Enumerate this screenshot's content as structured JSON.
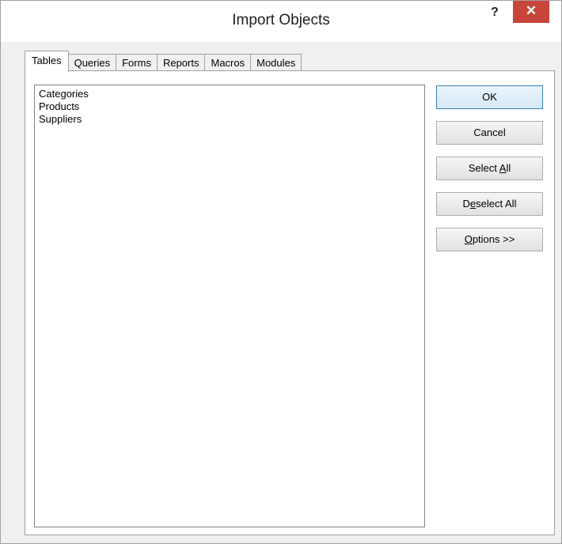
{
  "window": {
    "title": "Import Objects",
    "help_label": "?",
    "close_label": "✕"
  },
  "tabs": [
    {
      "label": "Tables",
      "active": true
    },
    {
      "label": "Queries",
      "active": false
    },
    {
      "label": "Forms",
      "active": false
    },
    {
      "label": "Reports",
      "active": false
    },
    {
      "label": "Macros",
      "active": false
    },
    {
      "label": "Modules",
      "active": false
    }
  ],
  "list": {
    "items": [
      "Categories",
      "Products",
      "Suppliers"
    ]
  },
  "buttons": {
    "ok": "OK",
    "cancel": "Cancel",
    "select_all_pre": "Select ",
    "select_all_key": "A",
    "select_all_post": "ll",
    "deselect_all_pre": "D",
    "deselect_all_key": "e",
    "deselect_all_post": "select All",
    "options_pre": "",
    "options_key": "O",
    "options_post": "ptions >>"
  },
  "colors": {
    "close_button": "#c7453a",
    "default_button_border": "#3c7fb1",
    "dialog_background": "#f0f0f0"
  }
}
